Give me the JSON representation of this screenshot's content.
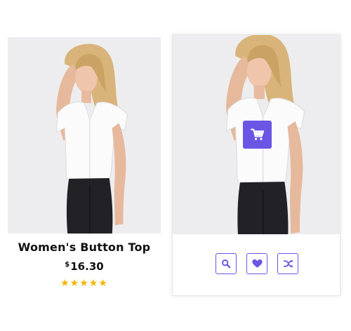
{
  "colors": {
    "accent": "#6a55e5",
    "star": "#f5b400"
  },
  "product": {
    "name": "Women's Button Top",
    "currency": "$",
    "price_value": "16.30",
    "rating": {
      "value": 5,
      "max": 5,
      "stars": "★★★★★"
    },
    "image_desc": "woman-in-white-button-top-photo"
  },
  "hover_card": {
    "cart_icon": "shopping-cart-icon",
    "actions": [
      {
        "icon": "search-icon"
      },
      {
        "icon": "heart-icon"
      },
      {
        "icon": "shuffle-icon"
      }
    ]
  }
}
